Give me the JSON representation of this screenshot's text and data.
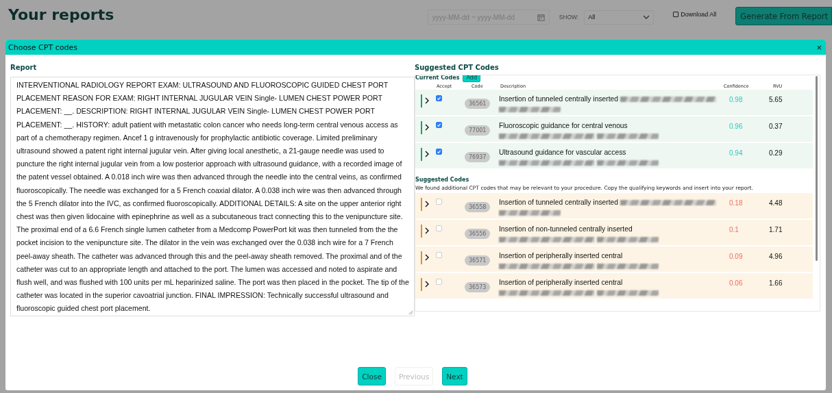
{
  "page": {
    "title": "Your reports",
    "date_range": {
      "placeholder": "yyyy-MM-dd ~ yyyy-MM-dd"
    },
    "show": {
      "label": "SHOW:",
      "value": "All"
    },
    "download_all": {
      "label": "Download All",
      "checked": false
    },
    "generate_button": "Generate From Report"
  },
  "dialog": {
    "title": "Choose CPT codes",
    "close": "×",
    "report": {
      "label": "Report",
      "text": "INTERVENTIONAL RADIOLOGY REPORT EXAM: ULTRASOUND AND FLUOROSCOPIC GUIDED CHEST PORT PLACEMENT REASON FOR EXAM: RIGHT INTERNAL JUGULAR VEIN Single- LUMEN CHEST POWER PORT PLACEMENT: __. DESCRIPTION: RIGHT INTERNAL JUGULAR VEIN Single- LUMEN CHEST POWER PORT PLACEMENT: __. HISTORY: adult patient with metastatic colon cancer who needs long-term central venous access as part of a chemotherapy regimen. Ancef 1 g intravenously for prophylactic antibiotic coverage. Limited preliminary ultrasound showed a patent right internal jugular vein. After giving local anesthetic, a 21-gauge needle was used to puncture the right internal jugular vein from a low posterior approach with ultrasound guidance, with a recorded image of the patent vessel obtained. A 0.018 inch wire was then advanced through the needle into the central veins, as confirmed fluoroscopically. The needle was exchanged for a 5 French coaxial dilator. A 0.038 inch wire was then advanced through the 5 French dilator into the IVC, as confirmed fluoroscopically. ADDITIONAL DETAILS: A site on the upper anterior right chest was then given lidocaine with epinephrine as well as a subcutaneous tract connecting this to the venipuncture site. The proximal end of a 6.6 French single lumen catheter from a Medcomp PowerPort kit was then tunneled from the the pocket incision to the venipuncture site. The dilator in the vein was exchanged over the 0.038 inch wire for a 7 French peel-away sheath. The catheter was advanced through this and the peel-away sheath removed. The proximal and of the catheter was cut to an appropriate length and attached to the port. The lumen was accessed and noted to aspirate and flush well, and was flushed with 100 units per mL heparinized saline. The port was then placed in the pocket. The tip of the catheter was located in the superior cavoatrial junction. FINAL IMPRESSION: Technically successful ultrasound and fluoroscopic guided chest port placement."
    },
    "suggested_panel": {
      "title": "Suggested CPT Codes",
      "columns": [
        "Accept",
        "Code",
        "Description",
        "Confidence",
        "RVU"
      ],
      "sections": [
        {
          "kind": "current",
          "title": "Current Codes",
          "add_button": "Add",
          "rows": [
            {
              "accepted": true,
              "code": "36561",
              "description": "Insertion of tunneled centrally inserted",
              "redacted": true,
              "confidence": "0.98",
              "rvu": "5.65"
            },
            {
              "accepted": true,
              "code": "77001",
              "description": "Fluoroscopic guidance for central venous",
              "redacted": true,
              "confidence": "0.96",
              "rvu": "0.37"
            },
            {
              "accepted": true,
              "code": "76937",
              "description": "Ultrasound guidance for vascular access",
              "redacted": true,
              "confidence": "0.94",
              "rvu": "0.29"
            }
          ]
        },
        {
          "kind": "suggested",
          "title": "Suggested Codes",
          "note": "We found additional CPT codes that may be relevant to your procedure. Copy the qualifying keywords and insert into your report.",
          "rows": [
            {
              "accepted": false,
              "code": "36558",
              "description": "Insertion of tunneled centrally inserted",
              "redacted": true,
              "confidence": "0.18",
              "rvu": "4.48"
            },
            {
              "accepted": false,
              "code": "36556",
              "description": "Insertion of non-tunneled centrally inserted",
              "redacted": true,
              "confidence": "0.1",
              "rvu": "1.71"
            },
            {
              "accepted": false,
              "code": "36571",
              "description": "Insertion of peripherally inserted central",
              "redacted": true,
              "confidence": "0.09",
              "rvu": "4.96"
            },
            {
              "accepted": false,
              "code": "36573",
              "description": "Insertion of peripherally inserted central",
              "redacted": true,
              "confidence": "0.06",
              "rvu": "1.66"
            }
          ]
        }
      ]
    },
    "buttons": [
      {
        "label": "Close",
        "disabled": false
      },
      {
        "label": "Previous",
        "disabled": true
      },
      {
        "label": "Next",
        "disabled": false
      }
    ]
  }
}
